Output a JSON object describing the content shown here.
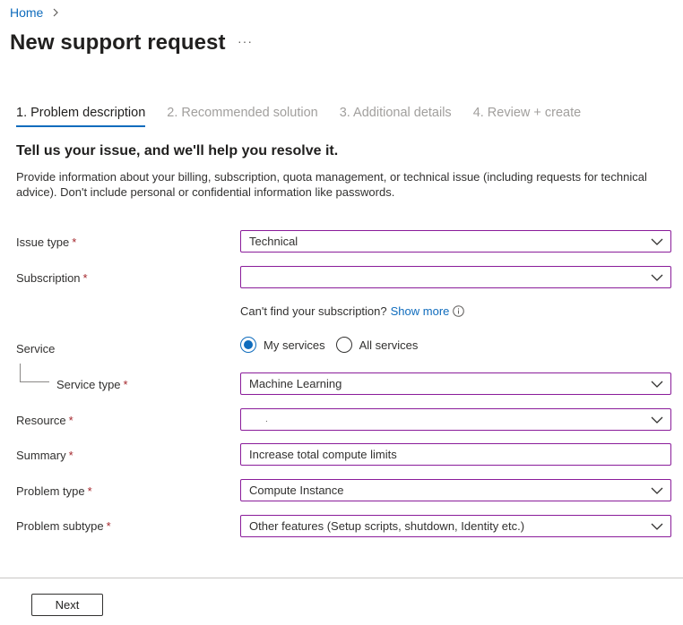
{
  "breadcrumb": {
    "home": "Home"
  },
  "page": {
    "title": "New support request",
    "more": "···"
  },
  "tabs": [
    {
      "label": "1. Problem description",
      "active": true
    },
    {
      "label": "2. Recommended solution",
      "active": false
    },
    {
      "label": "3. Additional details",
      "active": false
    },
    {
      "label": "4. Review + create",
      "active": false
    }
  ],
  "section": {
    "heading": "Tell us your issue, and we'll help you resolve it.",
    "description": "Provide information about your billing, subscription, quota management, or technical issue (including requests for technical advice). Don't include personal or confidential information like passwords."
  },
  "form": {
    "required_marker": "*",
    "issue_type": {
      "label": "Issue type",
      "value": "Technical"
    },
    "subscription": {
      "label": "Subscription",
      "value": ""
    },
    "subscription_hint": {
      "text": "Can't find your subscription?",
      "link": "Show more"
    },
    "service": {
      "label": "Service",
      "options": [
        "My services",
        "All services"
      ],
      "selected": "My services"
    },
    "service_type": {
      "label": "Service type",
      "value": "Machine Learning"
    },
    "resource": {
      "label": "Resource",
      "value": "."
    },
    "summary": {
      "label": "Summary",
      "value": "Increase total compute limits"
    },
    "problem_type": {
      "label": "Problem type",
      "value": "Compute Instance"
    },
    "problem_subtype": {
      "label": "Problem subtype",
      "value": "Other features (Setup scripts, shutdown, Identity etc.)"
    }
  },
  "footer": {
    "next_label": "Next"
  },
  "colors": {
    "accent": "#0f6cbd",
    "field_border": "#8a1c9a",
    "required": "#a4262c"
  }
}
